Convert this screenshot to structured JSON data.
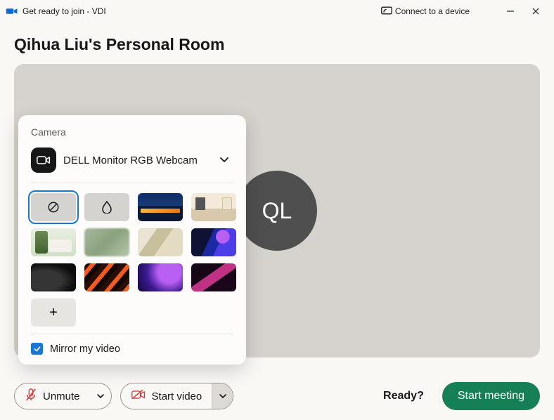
{
  "titlebar": {
    "title": "Get ready to join - VDI",
    "connect_device": "Connect to a device"
  },
  "page_title": "Qihua Liu's Personal Room",
  "avatar_initials": "QL",
  "camera_panel": {
    "section_label": "Camera",
    "selected_camera": "DELL Monitor RGB Webcam",
    "mirror_label": "Mirror my video",
    "mirror_checked": true,
    "backgrounds": [
      {
        "kind": "none",
        "selected": true
      },
      {
        "kind": "blur"
      },
      {
        "kind": "night"
      },
      {
        "kind": "room"
      },
      {
        "kind": "garden"
      },
      {
        "kind": "blurpic"
      },
      {
        "kind": "wash"
      },
      {
        "kind": "wave"
      },
      {
        "kind": "dark1"
      },
      {
        "kind": "lava"
      },
      {
        "kind": "purple"
      },
      {
        "kind": "magenta"
      },
      {
        "kind": "add"
      }
    ]
  },
  "controls": {
    "unmute_label": "Unmute",
    "startvideo_label": "Start video",
    "ready_label": "Ready?",
    "start_meeting_label": "Start meeting"
  }
}
